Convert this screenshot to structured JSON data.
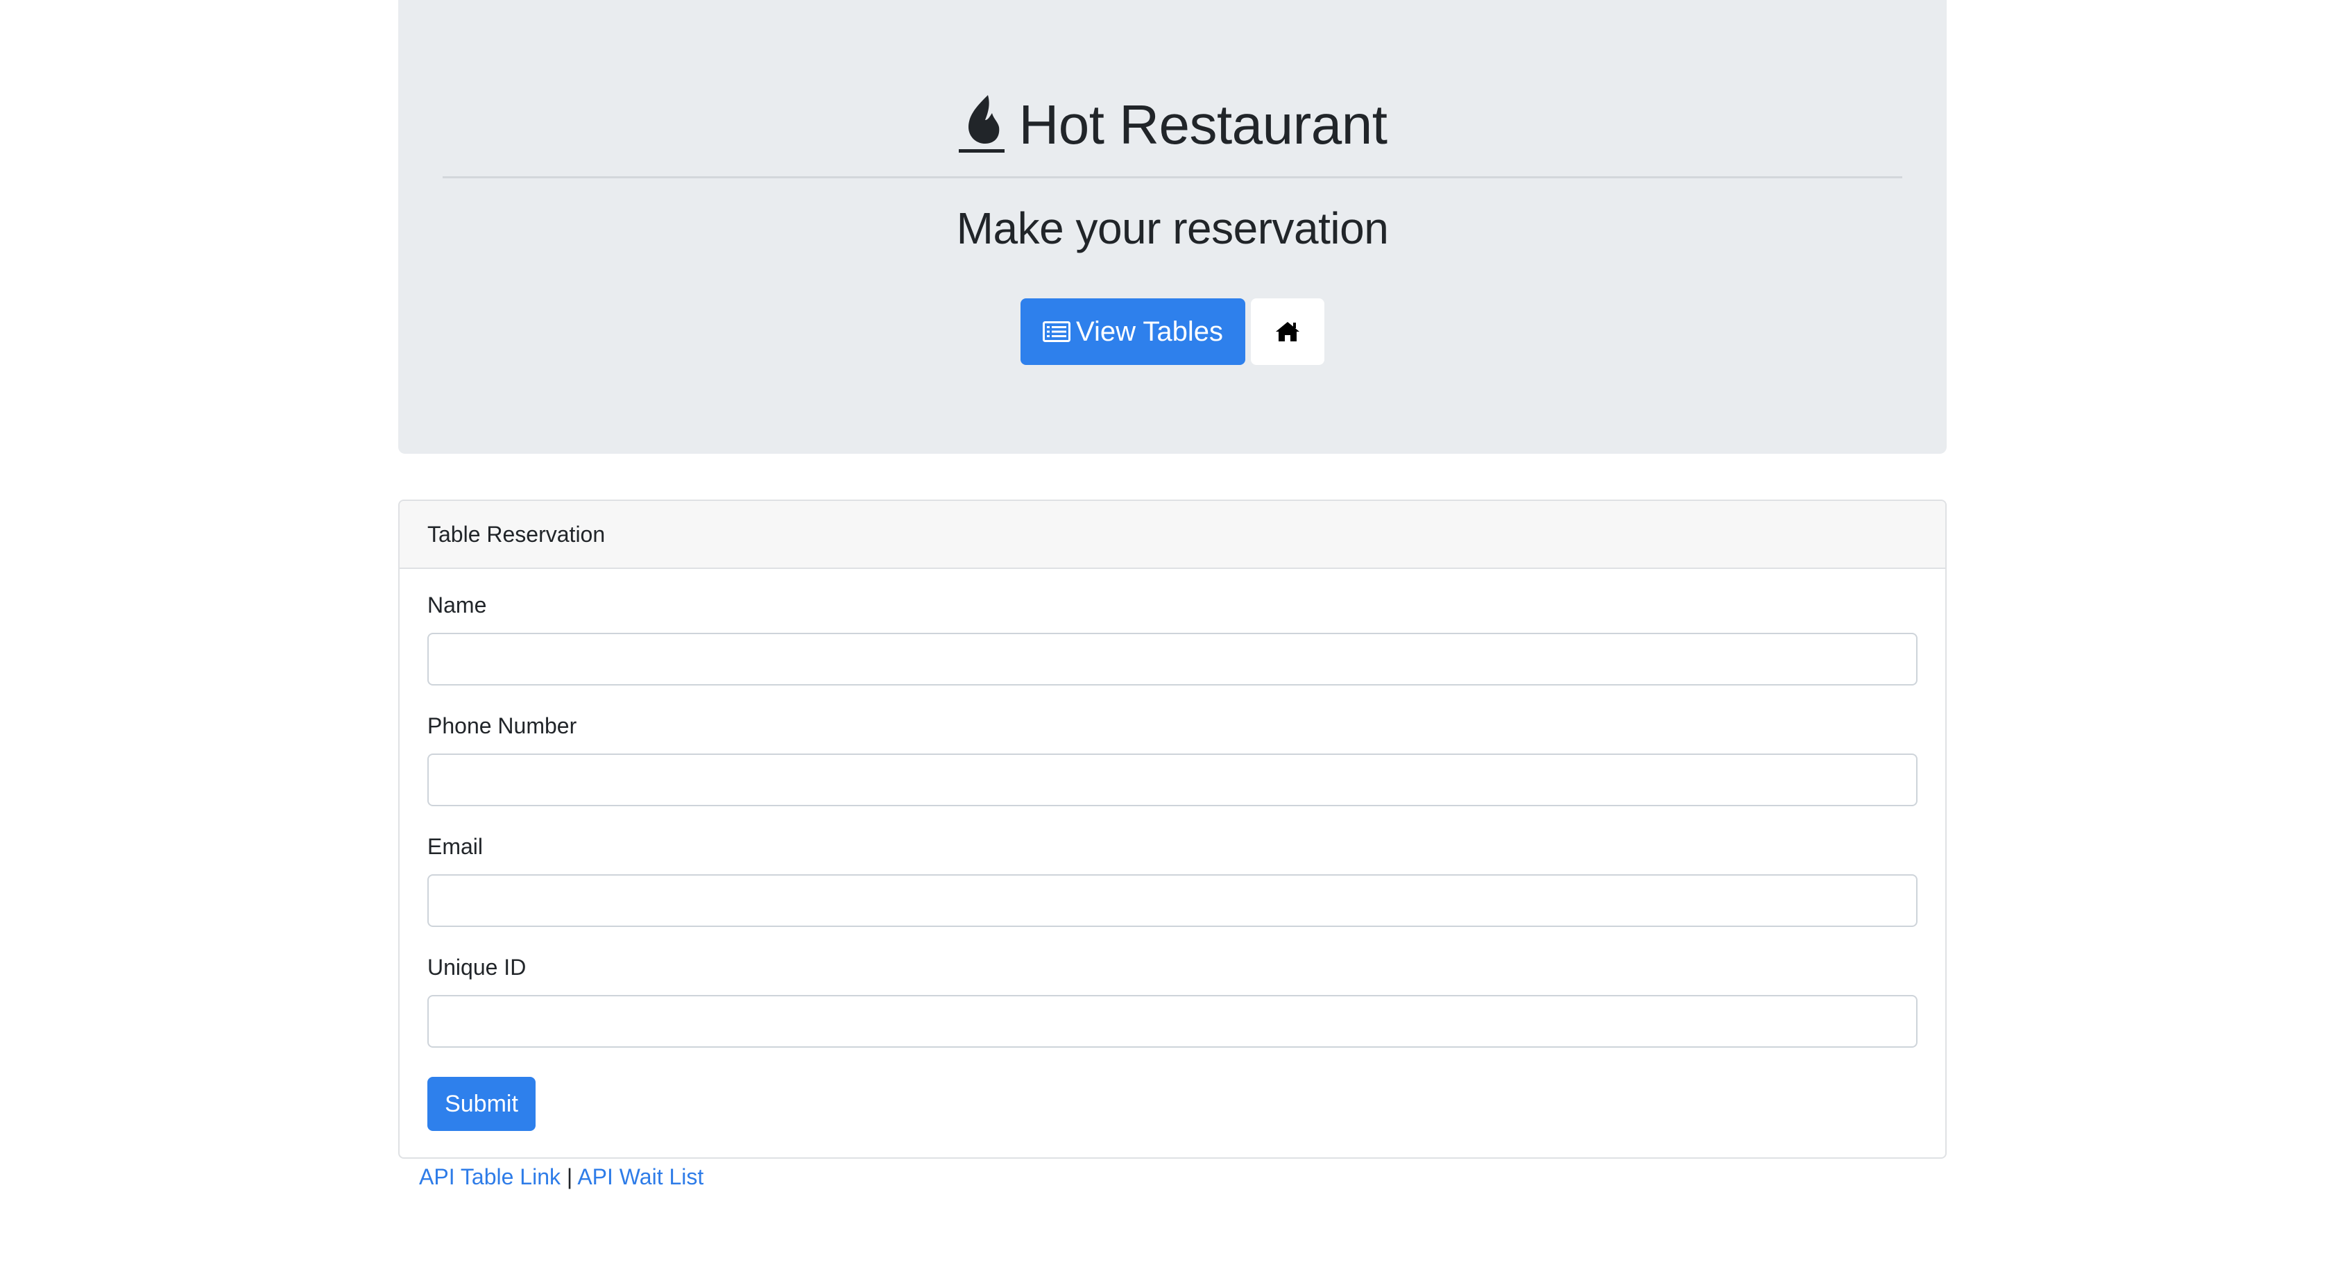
{
  "header": {
    "brand_icon": "fire-icon",
    "title": "Hot Restaurant",
    "subtitle": "Make your reservation",
    "view_tables_icon": "list-icon",
    "view_tables_label": "View Tables",
    "home_icon": "home-icon"
  },
  "card": {
    "title": "Table Reservation",
    "fields": [
      {
        "label": "Name",
        "value": ""
      },
      {
        "label": "Phone Number",
        "value": ""
      },
      {
        "label": "Email",
        "value": ""
      },
      {
        "label": "Unique ID",
        "value": ""
      }
    ],
    "submit_label": "Submit"
  },
  "footer": {
    "api_table_link": "API Table Link",
    "separator": "|",
    "api_wait_list": "API Wait List"
  },
  "colors": {
    "primary": "#2e80ec",
    "jumbotron_bg": "#e9ecef",
    "link": "#2e7ce8"
  }
}
